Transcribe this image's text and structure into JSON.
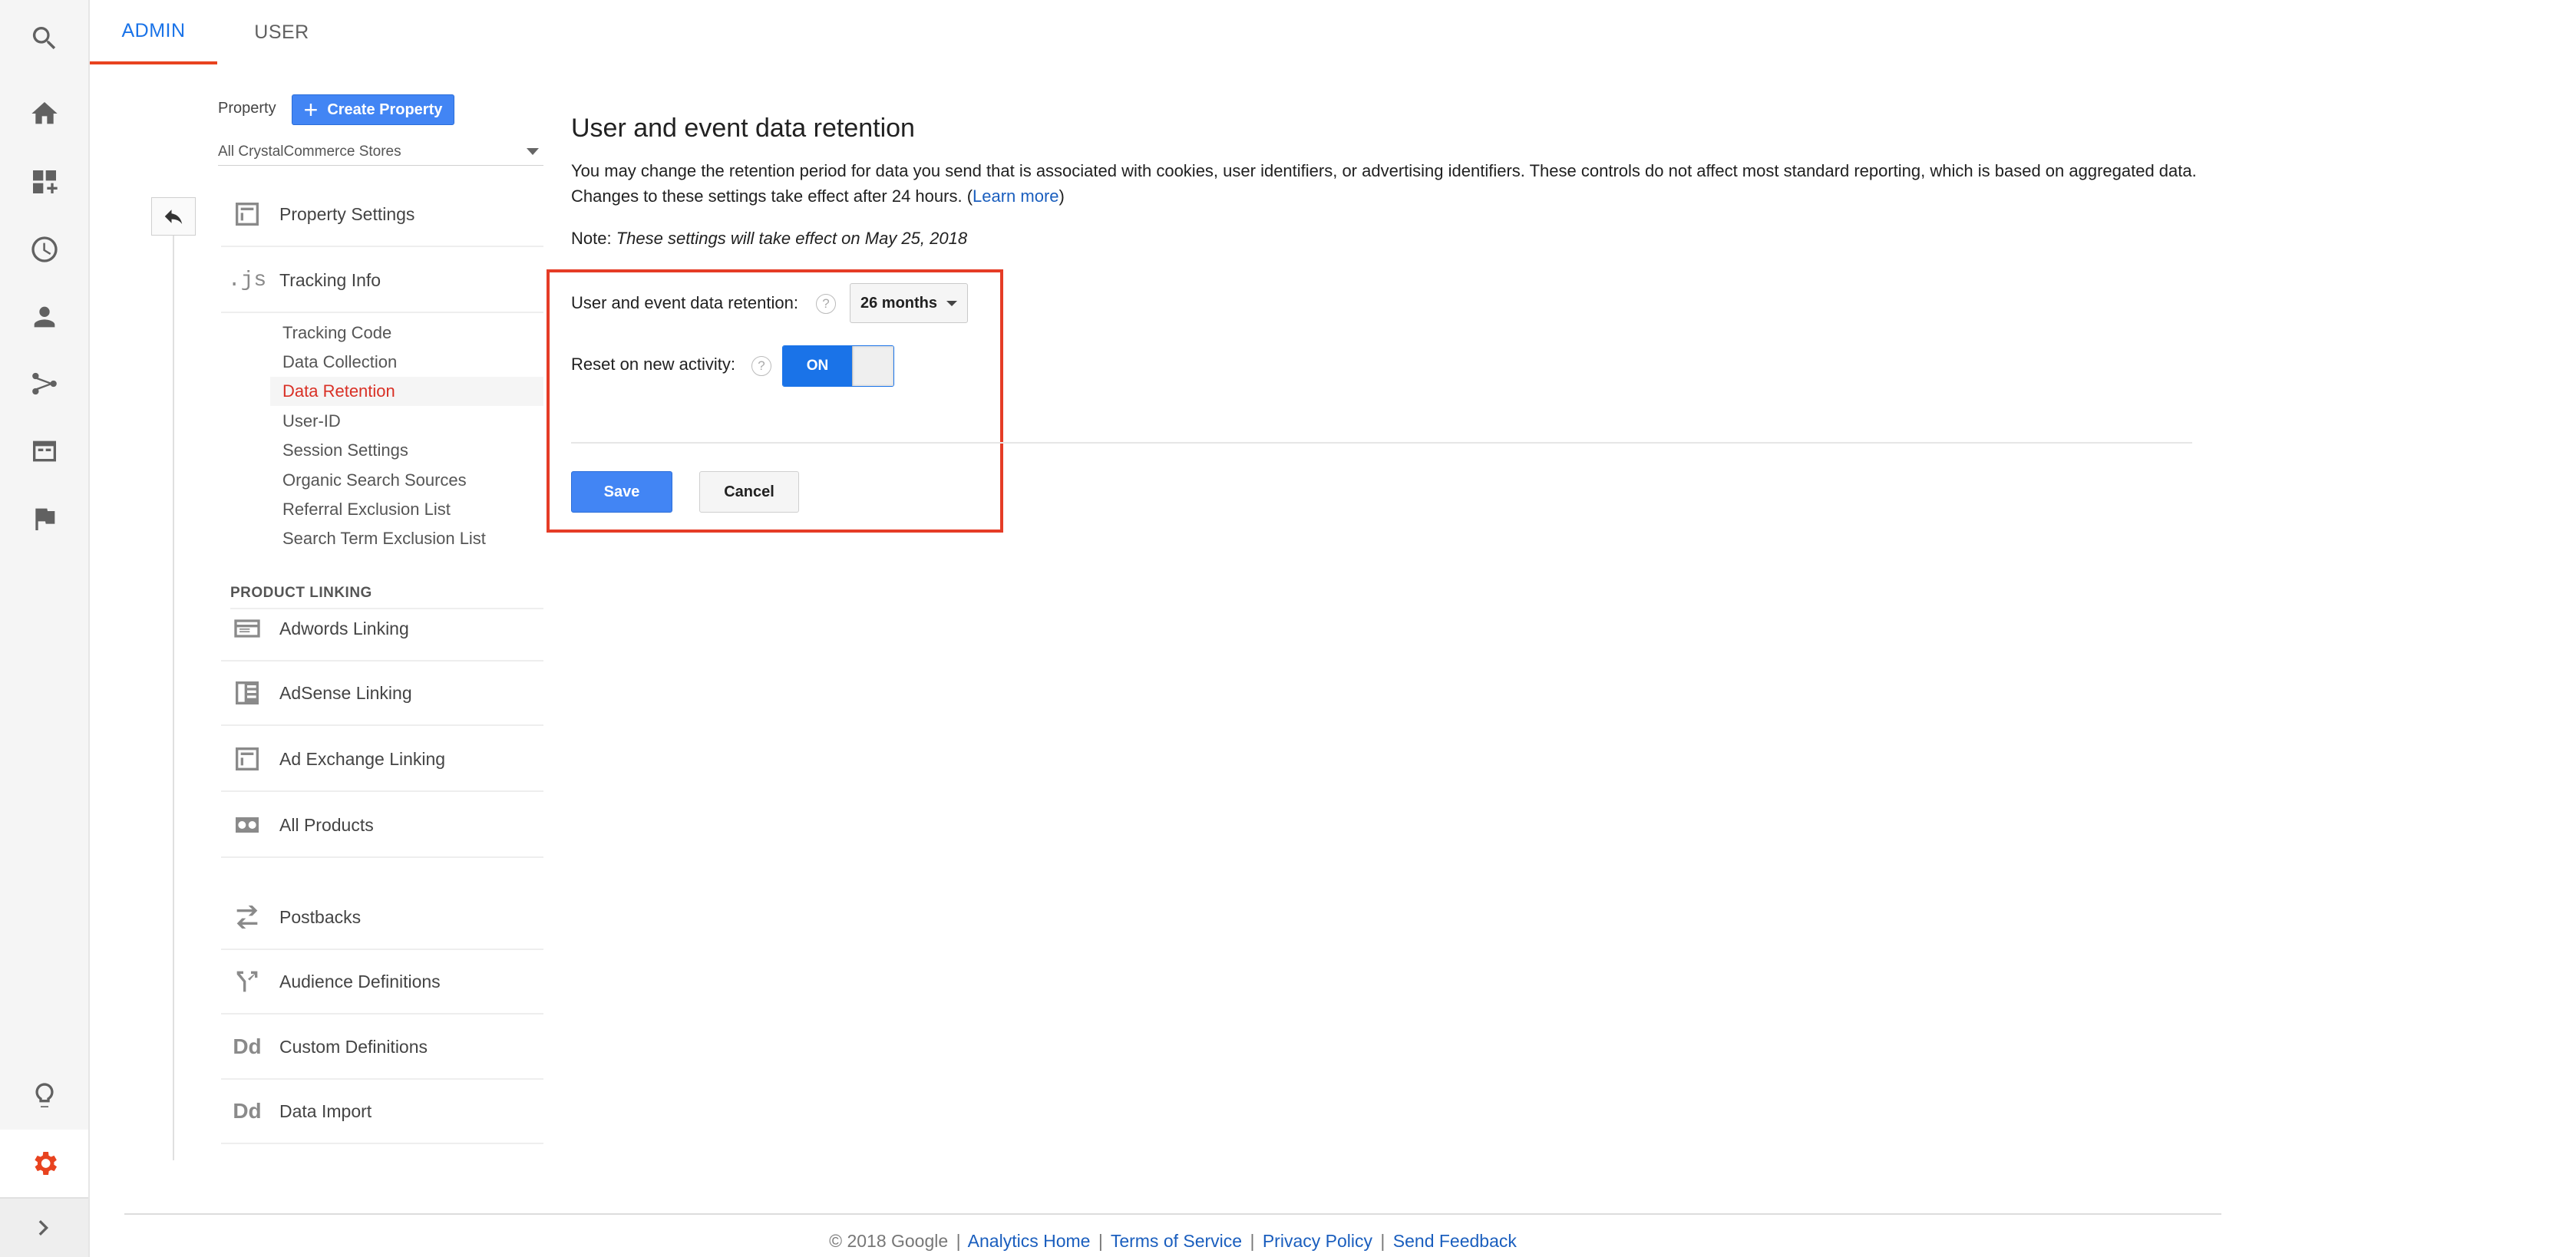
{
  "tabs": [
    {
      "label": "ADMIN",
      "active": true
    },
    {
      "label": "USER",
      "active": false
    }
  ],
  "rail": {
    "icons": [
      "search-icon",
      "home-icon",
      "customization-icon",
      "realtime-icon",
      "audience-icon",
      "acquisition-icon",
      "behavior-icon",
      "conversions-icon",
      "discover-icon",
      "settings-icon",
      "expand-icon"
    ],
    "active_color": "#e8431f"
  },
  "property": {
    "label": "Property",
    "create_label": "Create Property",
    "selected": "All CrystalCommerce Stores"
  },
  "nav": {
    "property_settings": "Property Settings",
    "tracking_info": "Tracking Info",
    "tracking_sub": [
      "Tracking Code",
      "Data Collection",
      "Data Retention",
      "User-ID",
      "Session Settings",
      "Organic Search Sources",
      "Referral Exclusion List",
      "Search Term Exclusion List"
    ],
    "active_sub": "Data Retention",
    "product_linking_header": "PRODUCT LINKING",
    "adwords": "Adwords Linking",
    "adsense": "AdSense Linking",
    "adexchange": "Ad Exchange Linking",
    "all_products": "All Products",
    "postbacks": "Postbacks",
    "audience_definitions": "Audience Definitions",
    "custom_definitions": "Custom Definitions",
    "data_import": "Data Import",
    "dd_text": "Dd",
    "js_text": ".js"
  },
  "main": {
    "title": "User and event data retention",
    "description": "You may change the retention period for data you send that is associated with cookies, user identifiers, or advertising identifiers. These controls do not affect most standard reporting, which is based on aggregated data. Changes to these settings take effect after 24 hours. (",
    "learn_more": "Learn more",
    "desc_close": ")",
    "note_prefix": "Note: ",
    "note_text": "These settings will take effect on May 25, 2018",
    "retention_label": "User and event data retention:",
    "retention_value": "26 months",
    "reset_label": "Reset on new activity:",
    "toggle_state": "ON",
    "help_glyph": "?",
    "save_label": "Save",
    "cancel_label": "Cancel",
    "highlight_color": "#e53c26"
  },
  "footer": {
    "copyright": "© 2018 Google",
    "links": [
      "Analytics Home",
      "Terms of Service",
      "Privacy Policy",
      "Send Feedback"
    ],
    "separator": "|"
  }
}
